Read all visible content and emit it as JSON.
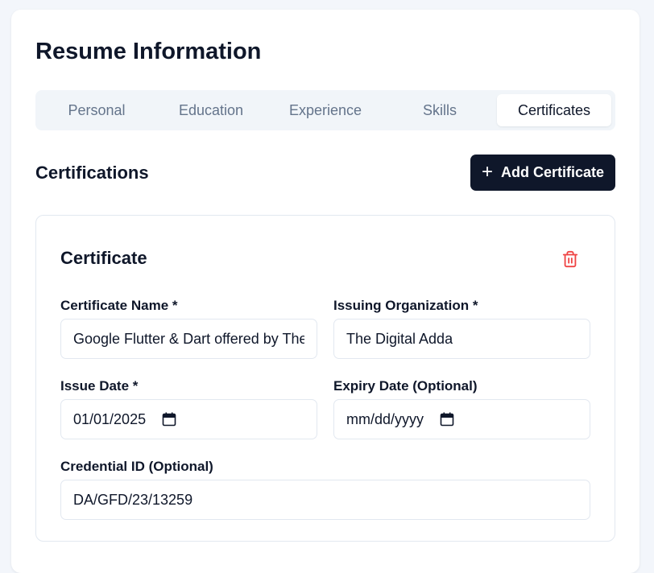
{
  "page": {
    "title": "Resume Information"
  },
  "tabs": [
    {
      "label": "Personal",
      "active": false
    },
    {
      "label": "Education",
      "active": false
    },
    {
      "label": "Experience",
      "active": false
    },
    {
      "label": "Skills",
      "active": false
    },
    {
      "label": "Certificates",
      "active": true
    }
  ],
  "section": {
    "title": "Certifications",
    "add_button_label": "Add Certificate",
    "add_icon": "plus-icon"
  },
  "certificate": {
    "heading": "Certificate",
    "delete_icon": "trash-icon",
    "fields": {
      "name": {
        "label": "Certificate Name *",
        "value": "Google Flutter & Dart offered by The Digital Adda"
      },
      "org": {
        "label": "Issuing Organization *",
        "value": "The Digital Adda"
      },
      "issue_date": {
        "label": "Issue Date *",
        "value": "01/01/2025"
      },
      "expiry_date": {
        "label": "Expiry Date (Optional)",
        "value": "mm/dd/yyyy"
      },
      "credential": {
        "label": "Credential ID (Optional)",
        "value": "DA/GFD/23/13259"
      }
    }
  },
  "colors": {
    "primary": "#0f172a",
    "muted": "#64748b",
    "danger": "#ef4444",
    "border": "#e2e8f0",
    "tab_bg": "#f1f5f9"
  }
}
